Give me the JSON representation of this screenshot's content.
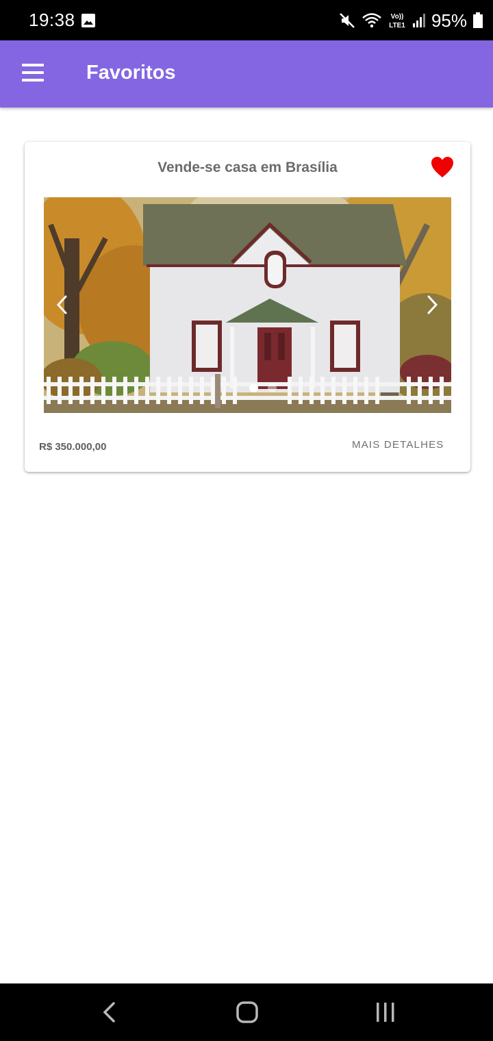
{
  "status_bar": {
    "time": "19:38",
    "battery": "95%",
    "icons": [
      "gallery-icon",
      "mute-icon",
      "wifi-icon",
      "volte-icon",
      "signal-icon",
      "battery-icon"
    ],
    "volte_label_top": "Vo))",
    "volte_label_bottom": "LTE1"
  },
  "app_bar": {
    "title": "Favoritos",
    "menu_icon": "menu-icon",
    "background": "#8466e2"
  },
  "listing": {
    "title": "Vende-se casa em Brasília",
    "favorite_icon": "heart-icon",
    "favorite_color": "#f00000",
    "price": "R$ 350.000,00",
    "details_label": "MAIS DETALHES",
    "image_description_icon": "house-photo",
    "carousel": {
      "slide_count": 2,
      "active_index": 0,
      "prev_icon": "chevron-left-icon",
      "next_icon": "chevron-right-icon"
    }
  },
  "nav_bar": {
    "icons": [
      "back-icon",
      "home-icon",
      "recents-icon"
    ]
  }
}
